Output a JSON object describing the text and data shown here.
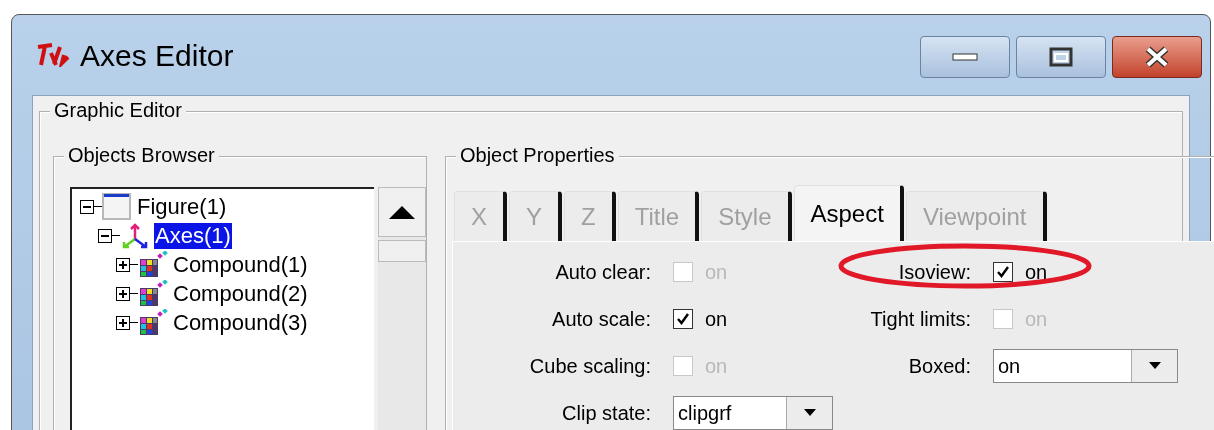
{
  "window": {
    "title": "Axes Editor"
  },
  "graphic_editor": {
    "title": "Graphic Editor"
  },
  "objects_browser": {
    "title": "Objects Browser",
    "tree": [
      {
        "label": "Figure(1)",
        "kind": "figure",
        "selected": false,
        "expanded": true,
        "children": [
          {
            "label": "Axes(1)",
            "kind": "axes",
            "selected": true,
            "expanded": true,
            "children": [
              {
                "label": "Compound(1)",
                "kind": "compound",
                "selected": false,
                "expanded": false
              },
              {
                "label": "Compound(2)",
                "kind": "compound",
                "selected": false,
                "expanded": false
              },
              {
                "label": "Compound(3)",
                "kind": "compound",
                "selected": false,
                "expanded": false
              }
            ]
          }
        ]
      }
    ]
  },
  "object_properties": {
    "title": "Object Properties",
    "tabs": [
      {
        "label": "X",
        "selected": false
      },
      {
        "label": "Y",
        "selected": false
      },
      {
        "label": "Z",
        "selected": false
      },
      {
        "label": "Title",
        "selected": false
      },
      {
        "label": "Style",
        "selected": false
      },
      {
        "label": "Aspect",
        "selected": true
      },
      {
        "label": "Viewpoint",
        "selected": false
      }
    ],
    "rows": [
      [
        {
          "kind": "checkbox",
          "label": "Auto clear:",
          "checked": false,
          "text": "on",
          "highlighted": false
        },
        {
          "kind": "checkbox",
          "label": "Isoview:",
          "checked": true,
          "text": "on",
          "highlighted": true
        }
      ],
      [
        {
          "kind": "checkbox",
          "label": "Auto scale:",
          "checked": true,
          "text": "on",
          "highlighted": false
        },
        {
          "kind": "checkbox",
          "label": "Tight limits:",
          "checked": false,
          "text": "on",
          "highlighted": false
        }
      ],
      [
        {
          "kind": "checkbox",
          "label": "Cube scaling:",
          "checked": false,
          "text": "on",
          "highlighted": false
        },
        {
          "kind": "select",
          "label": "Boxed:",
          "value": "on",
          "highlighted": false
        }
      ],
      [
        {
          "kind": "select",
          "label": "Clip state:",
          "value": "clipgrf",
          "highlighted": false
        }
      ]
    ]
  }
}
